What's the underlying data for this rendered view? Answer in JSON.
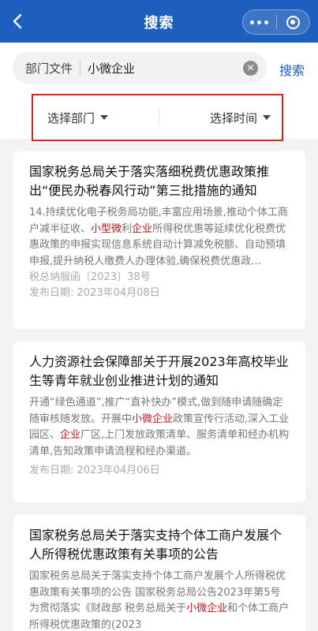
{
  "nav": {
    "title": "搜索"
  },
  "search": {
    "scope": "部门文件",
    "query": "小微企业",
    "button_label": "搜索"
  },
  "filters": {
    "department": "选择部门",
    "time": "选择时间"
  },
  "results": [
    {
      "title": "国家税务总局关于落实落细税费优惠政策推出“便民办税春风行动”第三批措施的通知",
      "snippet": [
        {
          "text": "14.持续优化电子税务局功能,丰富应用场景,推动个体工商户减半征收、"
        },
        {
          "text": "小型微",
          "hl": true
        },
        {
          "text": "利"
        },
        {
          "text": "企业",
          "hl": true
        },
        {
          "text": "所得税优惠等延续优化税费优惠政策的申报实现信息系统自动计算减免税额、自动预填申报,提升纳税人缴费人办理体验,确保税费优惠政..."
        }
      ],
      "doc_number": "税总纳服函〔2023〕38号",
      "date_label": "发布日期:",
      "date": "2023年04月08日"
    },
    {
      "title": "人力资源社会保障部关于开展2023年高校毕业生等青年就业创业推进计划的通知",
      "snippet": [
        {
          "text": "开通“绿色通道”,推广“直补快办”模式,做到随申请随确定随审核随发放。开展中"
        },
        {
          "text": "小微企业",
          "hl": true
        },
        {
          "text": "政策宣传行活动,深入工业园区、"
        },
        {
          "text": "企业",
          "hl": true
        },
        {
          "text": "厂区,上门发放政策清单、服务清单和经办机构清单,告知政策申请流程和经办渠道。"
        }
      ],
      "date_label": "发布日期:",
      "date": "2023年04月06日"
    },
    {
      "title": "国家税务总局关于落实支持个体工商户发展个人所得税优惠政策有关事项的公告",
      "snippet": [
        {
          "text": "国家税务总局关于落实支持个体工商户发展个人所得税优惠政策有关事项的公告 国家税务总局公告2023年第5号 为贯彻落实《财政部 税务总局关于"
        },
        {
          "text": "小微企业",
          "hl": true
        },
        {
          "text": "和个体工商户所得税优惠政策的(2023"
        }
      ]
    }
  ]
}
